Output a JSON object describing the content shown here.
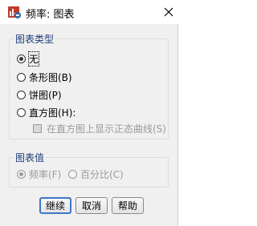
{
  "window": {
    "title": "频率: 图表",
    "close_glyph": "✕"
  },
  "chart_type_group": {
    "legend": "图表类型",
    "options": [
      {
        "label": "无",
        "selected": true
      },
      {
        "label": "条形图(B)",
        "selected": false
      },
      {
        "label": "饼图(P)",
        "selected": false
      },
      {
        "label": "直方图(H):",
        "selected": false
      }
    ],
    "normal_curve": {
      "label": "在直方图上显示正态曲线(S)",
      "checked": false,
      "enabled": false
    }
  },
  "chart_values_group": {
    "legend": "图表值",
    "options": [
      {
        "label": "频率(F)",
        "selected": true,
        "enabled": false
      },
      {
        "label": "百分比(C)",
        "selected": false,
        "enabled": false
      }
    ]
  },
  "buttons": {
    "continue": "继续",
    "cancel": "取消",
    "help": "帮助"
  },
  "icons": {
    "app": "spss-chart-icon",
    "close": "close-icon"
  }
}
